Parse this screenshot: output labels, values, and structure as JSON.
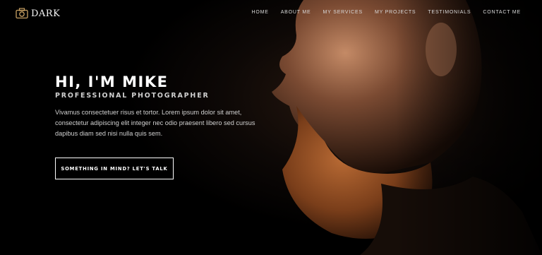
{
  "brand": {
    "logo_icon": "camera-icon",
    "name": "DARK",
    "accent": "#c8a062"
  },
  "nav": {
    "items": [
      "HOME",
      "ABOUT ME",
      "MY SERVICES",
      "MY PROJECTS",
      "TESTIMONIALS",
      "CONTACT ME"
    ]
  },
  "hero": {
    "headline": "HI, I'M MIKE",
    "subtitle": "PROFESSIONAL PHOTOGRAPHER",
    "body": "Vivamus consectetuer risus et tortor. Lorem ipsum dolor sit amet, consectetur adipiscing elit integer nec odio praesent libero sed cursus dapibus diam sed nisi nulla quis sem.",
    "cta_label": "SOMETHING IN MIND? LET'S TALK",
    "portrait_image": "portrait-photo-bearded-man"
  },
  "colors": {
    "background": "#000000",
    "text": "#ffffff"
  }
}
